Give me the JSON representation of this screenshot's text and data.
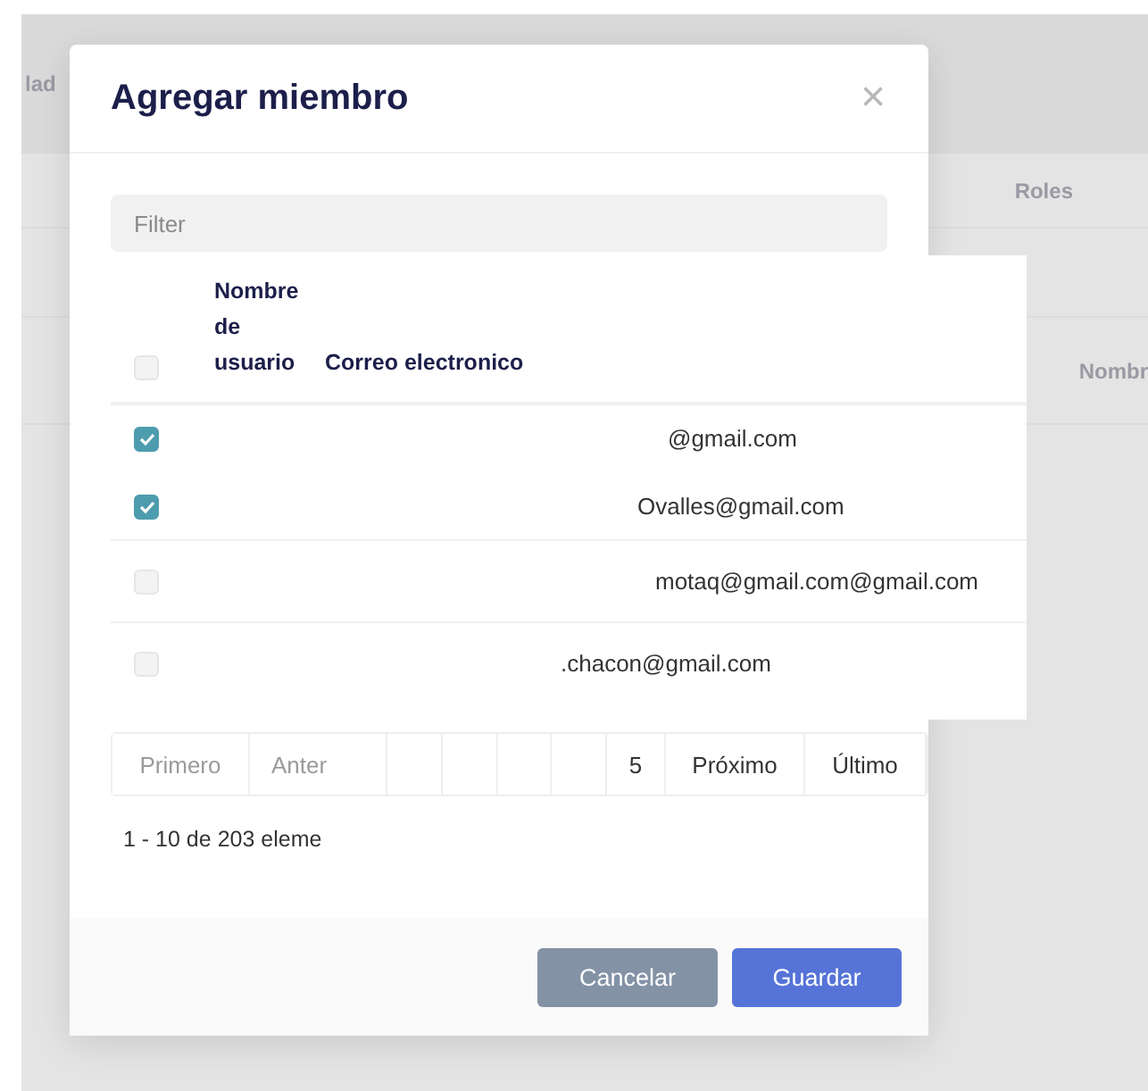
{
  "background": {
    "breadcrumb": "lad",
    "column_header": "Roles",
    "column_header_2": "Nombr"
  },
  "dialog": {
    "title": "Agregar miembro",
    "close": "×",
    "filter": {
      "placeholder": "Filter"
    },
    "table": {
      "select_all": {
        "checked": false
      },
      "columns": [
        "Nombre de usuario",
        "Correo electronico"
      ],
      "rows": [
        {
          "checked": true,
          "email": "@gmail.com"
        },
        {
          "checked": true,
          "email": "Ovalles@gmail.com"
        },
        {
          "checked": false,
          "email": "motaq@gmail.com@gmail.com"
        },
        {
          "checked": false,
          "email": ".chacon@gmail.com"
        }
      ]
    },
    "pagination": [
      {
        "label": "Primero",
        "disabled": true
      },
      {
        "label": "Anter",
        "disabled": true
      },
      {
        "label": "5",
        "disabled": false
      },
      {
        "label": "Próximo",
        "disabled": false
      },
      {
        "label": "Último",
        "disabled": false
      }
    ],
    "summary": "1 - 10 de 203 eleme",
    "buttons": [
      {
        "kind": "secondary",
        "label": "Cancelar"
      },
      {
        "kind": "primary",
        "label": "Guardar"
      }
    ]
  }
}
